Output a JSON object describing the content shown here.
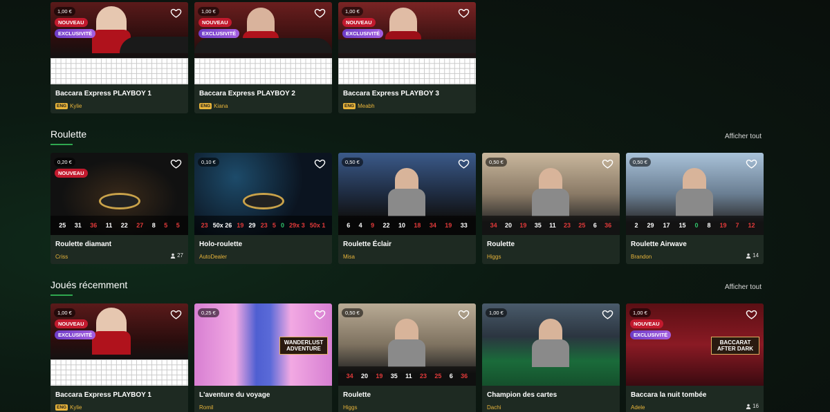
{
  "sections": {
    "roulette": {
      "title": "Roulette",
      "show_all": "Afficher tout"
    },
    "recent": {
      "title": "Joués récemment",
      "show_all": "Afficher tout"
    }
  },
  "row1": [
    {
      "title": "Baccara Express PLAYBOY 1",
      "lang": "ENG",
      "dealer": "Kylie",
      "price": "1,00 €",
      "badge_new": "NOUVEAU",
      "badge_excl": "EXCLUSIVITÉ"
    },
    {
      "title": "Baccara Express PLAYBOY 2",
      "lang": "ENG",
      "dealer": "Kiana",
      "price": "1,00 €",
      "badge_new": "NOUVEAU",
      "badge_excl": "EXCLUSIVITÉ"
    },
    {
      "title": "Baccara Express PLAYBOY 3",
      "lang": "ENG",
      "dealer": "Meabh",
      "price": "1,00 €",
      "badge_new": "NOUVEAU",
      "badge_excl": "EXCLUSIVITÉ"
    }
  ],
  "row2": [
    {
      "title": "Roulette diamant",
      "dealer": "Criss",
      "price": "0,20 €",
      "badge_new": "NOUVEAU",
      "players": "27",
      "results": [
        [
          "25",
          "w"
        ],
        [
          "31",
          "w"
        ],
        [
          "36",
          "r"
        ],
        [
          "11",
          "w"
        ],
        [
          "22",
          "w"
        ],
        [
          "27",
          "r"
        ],
        [
          "8",
          "w"
        ],
        [
          "5",
          "r"
        ],
        [
          "5",
          "r"
        ]
      ]
    },
    {
      "title": "Holo-roulette",
      "dealer": "AutoDealer",
      "price": "0,10 €",
      "results": [
        [
          "23",
          "r"
        ],
        [
          "50x 26",
          "w"
        ],
        [
          "19",
          "r"
        ],
        [
          "29",
          "w"
        ],
        [
          "23",
          "r"
        ],
        [
          "5",
          "r"
        ],
        [
          "0",
          "g"
        ],
        [
          "29x 3",
          "r"
        ],
        [
          "50x 1",
          "r"
        ]
      ]
    },
    {
      "title": "Roulette Éclair",
      "dealer": "Misa",
      "price": "0,50 €",
      "results": [
        [
          "6",
          "w"
        ],
        [
          "4",
          "w"
        ],
        [
          "9",
          "r"
        ],
        [
          "22",
          "w"
        ],
        [
          "10",
          "w"
        ],
        [
          "18",
          "r"
        ],
        [
          "34",
          "r"
        ],
        [
          "19",
          "r"
        ],
        [
          "33",
          "w"
        ]
      ]
    },
    {
      "title": "Roulette",
      "dealer": "Higgs",
      "price": "0,50 €",
      "results": [
        [
          "34",
          "r"
        ],
        [
          "20",
          "w"
        ],
        [
          "19",
          "r"
        ],
        [
          "35",
          "w"
        ],
        [
          "11",
          "w"
        ],
        [
          "23",
          "r"
        ],
        [
          "25",
          "r"
        ],
        [
          "6",
          "w"
        ],
        [
          "36",
          "r"
        ]
      ]
    },
    {
      "title": "Roulette Airwave",
      "dealer": "Brandon",
      "price": "0,50 €",
      "players": "14",
      "results": [
        [
          "2",
          "w"
        ],
        [
          "29",
          "w"
        ],
        [
          "17",
          "w"
        ],
        [
          "15",
          "w"
        ],
        [
          "0",
          "g"
        ],
        [
          "8",
          "w"
        ],
        [
          "19",
          "r"
        ],
        [
          "7",
          "r"
        ],
        [
          "12",
          "r"
        ]
      ]
    }
  ],
  "row3": [
    {
      "title": "Baccara Express PLAYBOY 1",
      "lang": "ENG",
      "dealer": "Kylie",
      "price": "1,00 €",
      "badge_new": "NOUVEAU",
      "badge_excl": "EXCLUSIVITÉ"
    },
    {
      "title": "L'aventure du voyage",
      "dealer": "Romil",
      "price": "0,25 €",
      "logo": "WANDERLUST ADVENTURE"
    },
    {
      "title": "Roulette",
      "dealer": "Higgs",
      "price": "0,50 €",
      "results": [
        [
          "34",
          "r"
        ],
        [
          "20",
          "w"
        ],
        [
          "19",
          "r"
        ],
        [
          "35",
          "w"
        ],
        [
          "11",
          "w"
        ],
        [
          "23",
          "r"
        ],
        [
          "25",
          "r"
        ],
        [
          "6",
          "w"
        ],
        [
          "36",
          "r"
        ]
      ]
    },
    {
      "title": "Champion des cartes",
      "dealer": "Dachi",
      "price": "1,00 €"
    },
    {
      "title": "Baccara la nuit tombée",
      "dealer": "Adele",
      "price": "1,00 €",
      "badge_new": "NOUVEAU",
      "badge_excl": "EXCLUSIVITÉ",
      "players": "16",
      "logo": "BACCARAT AFTER DARK"
    }
  ]
}
